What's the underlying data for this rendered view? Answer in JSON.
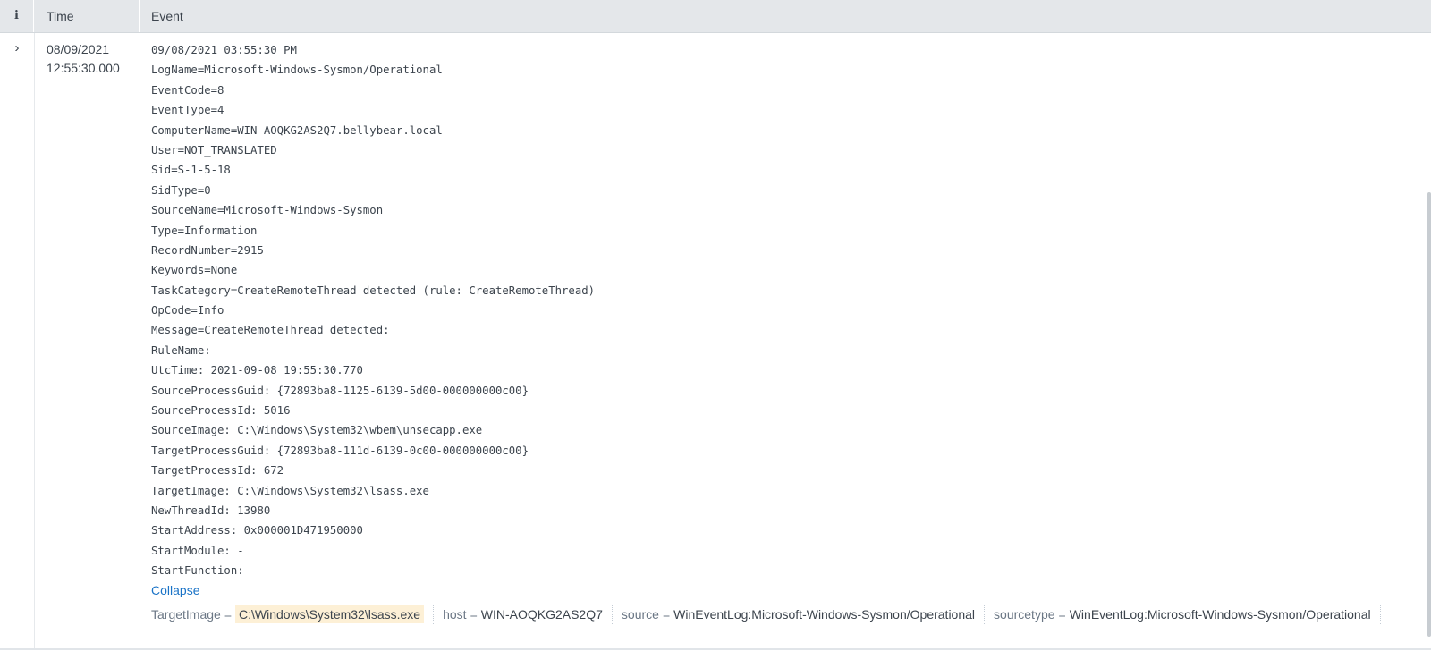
{
  "header": {
    "info_label": "i",
    "time_label": "Time",
    "event_label": "Event"
  },
  "row": {
    "expand_glyph": "›",
    "time_date": "08/09/2021",
    "time_clock": "12:55:30.000",
    "event_lines": [
      "09/08/2021 03:55:30 PM",
      "LogName=Microsoft-Windows-Sysmon/Operational",
      "EventCode=8",
      "EventType=4",
      "ComputerName=WIN-AOQKG2AS2Q7.bellybear.local",
      "User=NOT_TRANSLATED",
      "Sid=S-1-5-18",
      "SidType=0",
      "SourceName=Microsoft-Windows-Sysmon",
      "Type=Information",
      "RecordNumber=2915",
      "Keywords=None",
      "TaskCategory=CreateRemoteThread detected (rule: CreateRemoteThread)",
      "OpCode=Info",
      "Message=CreateRemoteThread detected:",
      "RuleName: -",
      "UtcTime: 2021-09-08 19:55:30.770",
      "SourceProcessGuid: {72893ba8-1125-6139-5d00-000000000c00}",
      "SourceProcessId: 5016",
      "SourceImage: C:\\Windows\\System32\\wbem\\unsecapp.exe",
      "TargetProcessGuid: {72893ba8-111d-6139-0c00-000000000c00}",
      "TargetProcessId: 672",
      "TargetImage: C:\\Windows\\System32\\lsass.exe",
      "NewThreadId: 13980",
      "StartAddress: 0x000001D471950000",
      "StartModule: -",
      "StartFunction: -"
    ],
    "collapse_label": "Collapse",
    "fields": [
      {
        "key": "TargetImage",
        "value": "C:\\Windows\\System32\\lsass.exe",
        "highlight": true
      },
      {
        "key": "host",
        "value": "WIN-AOQKG2AS2Q7",
        "highlight": false
      },
      {
        "key": "source",
        "value": "WinEventLog:Microsoft-Windows-Sysmon/Operational",
        "highlight": false
      },
      {
        "key": "sourcetype",
        "value": "WinEventLog:Microsoft-Windows-Sysmon/Operational",
        "highlight": false
      }
    ]
  },
  "colors": {
    "header_bg": "#e4e7ea",
    "link": "#1a73c7",
    "highlight_bg": "#fdf0d6"
  }
}
